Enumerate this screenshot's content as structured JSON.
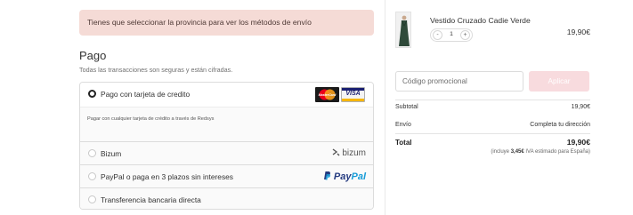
{
  "alert": {
    "text": "Tienes que seleccionar la provincia para ver los métodos de envío"
  },
  "payment": {
    "title": "Pago",
    "subtitle": "Todas las transacciones son seguras y están cifradas.",
    "methods": [
      {
        "label": "Pago con tarjeta de credito",
        "selected": true,
        "description": "Pagar con cualquier tarjeta de crédito a través de Redsys",
        "logos": [
          "MasterCard",
          "VISA"
        ]
      },
      {
        "label": "Bizum",
        "selected": false,
        "logo_text": "bizum"
      },
      {
        "label": "PayPal o paga en 3 plazos sin intereses",
        "selected": false,
        "logo_text_1": "Pay",
        "logo_text_2": "Pal"
      },
      {
        "label": "Transferencia bancaria directa",
        "selected": false
      }
    ]
  },
  "cart": {
    "product": {
      "name": "Vestido Cruzado Cadie Verde",
      "quantity": "1",
      "minus": "-",
      "plus": "+",
      "price": "19,90€"
    },
    "promo": {
      "placeholder": "Código promocional",
      "button": "Aplicar"
    },
    "summary": {
      "subtotal_label": "Subtotal",
      "subtotal_value": "19,90€",
      "shipping_label": "Envío",
      "shipping_value": "Completa tu dirección",
      "total_label": "Total",
      "total_value": "19,90€",
      "tax_prefix": "(incluye",
      "tax_amount": "3,45€",
      "tax_suffix": "IVA estimado para España)"
    }
  },
  "colors": {
    "alert_bg": "#f5dbd6",
    "apply_button": "#f8dbde",
    "paypal_dark": "#253b80",
    "paypal_light": "#179bd7",
    "visa_blue": "#1a1f71"
  }
}
